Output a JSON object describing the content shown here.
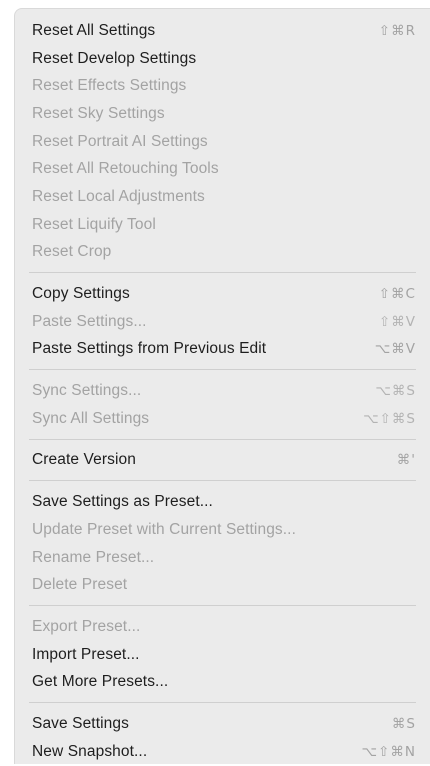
{
  "groups": [
    {
      "items": [
        {
          "label": "Reset All Settings",
          "shortcut": "⇧⌘R",
          "enabled": true
        },
        {
          "label": "Reset Develop Settings",
          "shortcut": "",
          "enabled": true
        },
        {
          "label": "Reset Effects Settings",
          "shortcut": "",
          "enabled": false
        },
        {
          "label": "Reset Sky Settings",
          "shortcut": "",
          "enabled": false
        },
        {
          "label": "Reset Portrait AI Settings",
          "shortcut": "",
          "enabled": false
        },
        {
          "label": "Reset All Retouching Tools",
          "shortcut": "",
          "enabled": false
        },
        {
          "label": "Reset Local Adjustments",
          "shortcut": "",
          "enabled": false
        },
        {
          "label": "Reset Liquify Tool",
          "shortcut": "",
          "enabled": false
        },
        {
          "label": "Reset Crop",
          "shortcut": "",
          "enabled": false
        }
      ]
    },
    {
      "items": [
        {
          "label": "Copy Settings",
          "shortcut": "⇧⌘C",
          "enabled": true
        },
        {
          "label": "Paste Settings...",
          "shortcut": "⇧⌘V",
          "enabled": false
        },
        {
          "label": "Paste Settings from Previous Edit",
          "shortcut": "⌥⌘V",
          "enabled": true
        }
      ]
    },
    {
      "items": [
        {
          "label": "Sync Settings...",
          "shortcut": "⌥⌘S",
          "enabled": false
        },
        {
          "label": "Sync All Settings",
          "shortcut": "⌥⇧⌘S",
          "enabled": false
        }
      ]
    },
    {
      "items": [
        {
          "label": "Create Version",
          "shortcut": "⌘'",
          "enabled": true
        }
      ]
    },
    {
      "items": [
        {
          "label": "Save Settings as Preset...",
          "shortcut": "",
          "enabled": true
        },
        {
          "label": "Update Preset with Current Settings...",
          "shortcut": "",
          "enabled": false
        },
        {
          "label": "Rename Preset...",
          "shortcut": "",
          "enabled": false
        },
        {
          "label": "Delete Preset",
          "shortcut": "",
          "enabled": false
        }
      ]
    },
    {
      "items": [
        {
          "label": "Export Preset...",
          "shortcut": "",
          "enabled": false
        },
        {
          "label": "Import Preset...",
          "shortcut": "",
          "enabled": true
        },
        {
          "label": "Get More Presets...",
          "shortcut": "",
          "enabled": true
        }
      ]
    },
    {
      "items": [
        {
          "label": "Save Settings",
          "shortcut": "⌘S",
          "enabled": true
        },
        {
          "label": "New Snapshot...",
          "shortcut": "⌥⇧⌘N",
          "enabled": true
        }
      ]
    }
  ]
}
